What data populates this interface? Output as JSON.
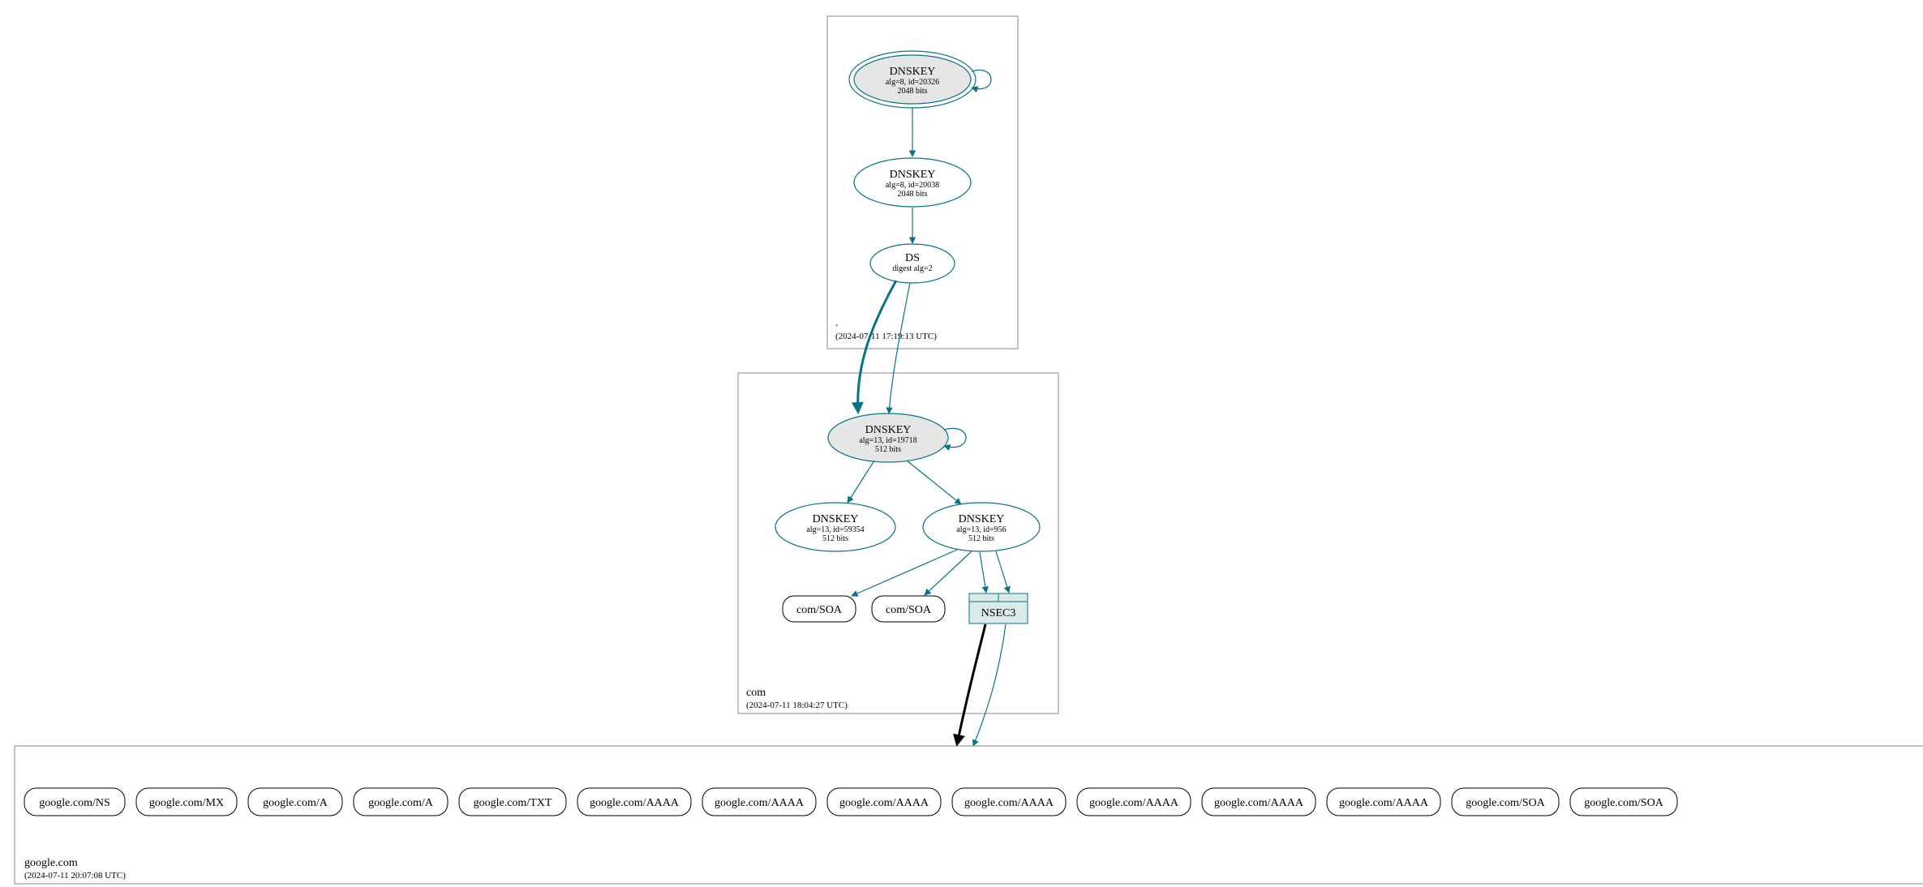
{
  "colors": {
    "teal": "#0b7285",
    "ksk_fill": "#e6e6e6",
    "nsec3_fill": "#dbe9e9"
  },
  "zones": {
    "root": {
      "name": ".",
      "timestamp": "(2024-07-11 17:19:13 UTC)",
      "ksk": {
        "title": "DNSKEY",
        "line1": "alg=8, id=20326",
        "line2": "2048 bits"
      },
      "zsk": {
        "title": "DNSKEY",
        "line1": "alg=8, id=20038",
        "line2": "2048 bits"
      },
      "ds": {
        "title": "DS",
        "line1": "digest alg=2"
      }
    },
    "com": {
      "name": "com",
      "timestamp": "(2024-07-11 18:04:27 UTC)",
      "ksk": {
        "title": "DNSKEY",
        "line1": "alg=13, id=19718",
        "line2": "512 bits"
      },
      "zsk_a": {
        "title": "DNSKEY",
        "line1": "alg=13, id=59354",
        "line2": "512 bits"
      },
      "zsk_b": {
        "title": "DNSKEY",
        "line1": "alg=13, id=956",
        "line2": "512 bits"
      },
      "soa_a": "com/SOA",
      "soa_b": "com/SOA",
      "nsec3": "NSEC3"
    },
    "google": {
      "name": "google.com",
      "timestamp": "(2024-07-11 20:07:08 UTC)",
      "rrsets": [
        "google.com/NS",
        "google.com/MX",
        "google.com/A",
        "google.com/A",
        "google.com/TXT",
        "google.com/AAAA",
        "google.com/AAAA",
        "google.com/AAAA",
        "google.com/AAAA",
        "google.com/AAAA",
        "google.com/AAAA",
        "google.com/AAAA",
        "google.com/SOA",
        "google.com/SOA"
      ]
    }
  }
}
